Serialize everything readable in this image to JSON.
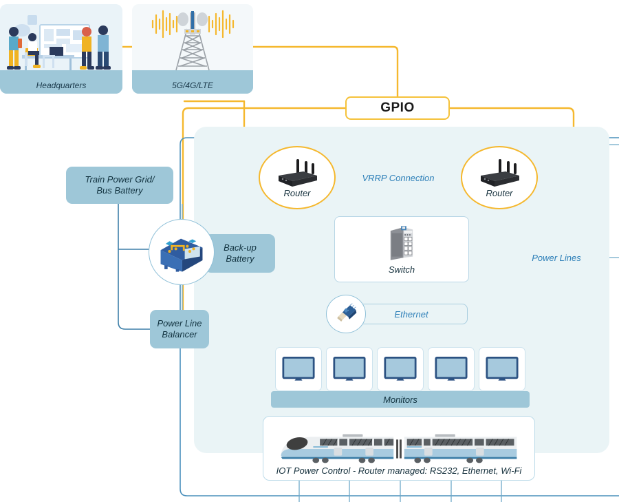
{
  "diagram": {
    "title": "Railway IoT Power Control Network Diagram",
    "colors": {
      "accent_yellow": "#f5b82e",
      "accent_blue": "#2d7fb8",
      "pill_blue": "#9ec7d8",
      "panel_blue": "#eaf4f6",
      "line_blue": "#9cc4d8"
    }
  },
  "top": {
    "headquarters": {
      "label": "Headquarters",
      "icon": "office-team-illustration"
    },
    "cellular": {
      "label": "5G/4G/LTE",
      "icon": "cell-tower-icon"
    }
  },
  "gpio": {
    "label": "GPIO"
  },
  "routers": [
    {
      "label": "Router",
      "icon": "router-icon"
    },
    {
      "label": "Router",
      "icon": "router-icon"
    }
  ],
  "links": {
    "vrrp": "VRRP Connection",
    "power_lines": "Power Lines",
    "ethernet": "Ethernet"
  },
  "switch": {
    "label": "Switch",
    "icon": "network-switch-icon"
  },
  "ethernet_connector": {
    "icon": "rj45-connector-icon"
  },
  "power": {
    "grid": "Train Power Grid/\nBus Battery",
    "grid_line1": "Train Power Grid/",
    "grid_line2": "Bus Battery",
    "backup_battery_line1": "Back-up",
    "backup_battery_line2": "Battery",
    "backup_battery_icon": "car-battery-icon",
    "balancer_line1": "Power Line",
    "balancer_line2": "Balancer"
  },
  "monitors": {
    "label": "Monitors",
    "count": 5,
    "items": [
      {
        "icon": "monitor-icon"
      },
      {
        "icon": "monitor-icon"
      },
      {
        "icon": "monitor-icon"
      },
      {
        "icon": "monitor-icon"
      },
      {
        "icon": "monitor-icon"
      }
    ]
  },
  "train": {
    "caption": "IOT Power Control - Router managed: RS232, Ethernet, Wi-Fi",
    "icon": "high-speed-train-icon"
  }
}
